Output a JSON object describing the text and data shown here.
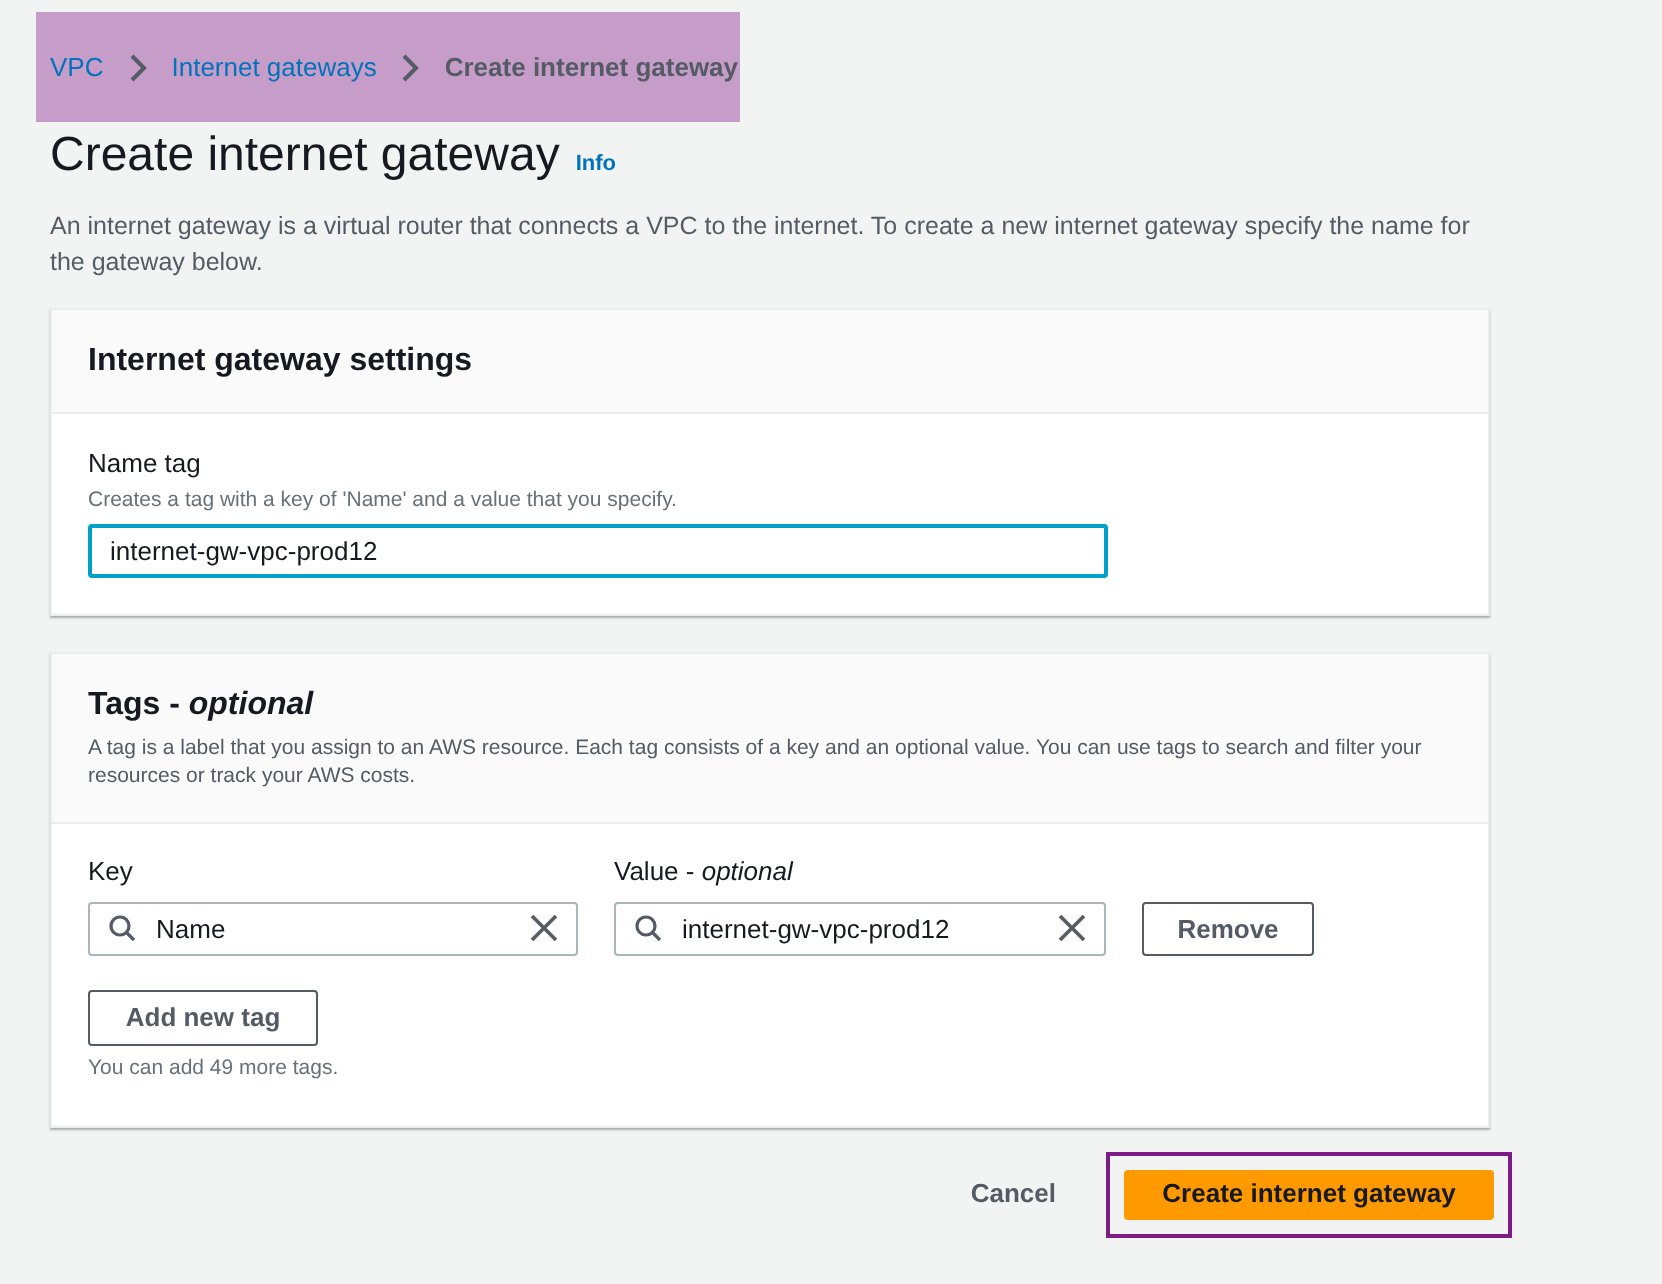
{
  "breadcrumb": [
    {
      "label": "VPC",
      "current": false
    },
    {
      "label": "Internet gateways",
      "current": false
    },
    {
      "label": "Create internet gateway",
      "current": true
    }
  ],
  "page": {
    "title": "Create internet gateway",
    "info": "Info",
    "description": "An internet gateway is a virtual router that connects a VPC to the internet. To create a new internet gateway specify the name for the gateway below."
  },
  "settings": {
    "title": "Internet gateway settings",
    "label": "Name tag",
    "hint": "Creates a tag with a key of 'Name' and a value that you specify.",
    "value": "internet-gw-vpc-prod12",
    "focused": true
  },
  "tags": {
    "title": "Tags - *optional*",
    "description": "A tag is a label that you assign to an AWS resource. Each tag consists of a key and an optional value. You can use tags to search and filter your resources or track your AWS costs.",
    "key_label": "Key",
    "value_label": "Value - *optional*",
    "rows": [
      {
        "key": "Name",
        "value": "internet-gw-vpc-prod12",
        "remove": "Remove"
      }
    ],
    "add_button": "Add new tag",
    "limit": "You can add 49 more tags."
  },
  "actions": {
    "cancel": "Cancel",
    "submit": "Create internet gateway"
  }
}
